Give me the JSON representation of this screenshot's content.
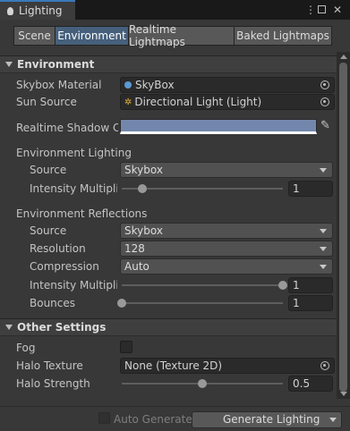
{
  "window": {
    "title": "Lighting"
  },
  "toolbar": {
    "tabs": [
      "Scene",
      "Environment",
      "Realtime Lightmaps",
      "Baked Lightmaps"
    ],
    "active": "Environment"
  },
  "environment": {
    "header": "Environment",
    "skybox_material": {
      "label": "Skybox Material",
      "value": "SkyBox"
    },
    "sun_source": {
      "label": "Sun Source",
      "value": "Directional Light (Light)"
    },
    "shadow_color": {
      "label": "Realtime Shadow Color",
      "color": "#7387ac"
    },
    "lighting": {
      "header": "Environment Lighting",
      "source": {
        "label": "Source",
        "value": "Skybox"
      },
      "intensity": {
        "label": "Intensity Multiplier",
        "value": "1",
        "fraction": 0.125
      }
    },
    "reflections": {
      "header": "Environment Reflections",
      "source": {
        "label": "Source",
        "value": "Skybox"
      },
      "resolution": {
        "label": "Resolution",
        "value": "128"
      },
      "compression": {
        "label": "Compression",
        "value": "Auto"
      },
      "intensity": {
        "label": "Intensity Multiplier",
        "value": "1",
        "fraction": 1.0
      },
      "bounces": {
        "label": "Bounces",
        "value": "1",
        "fraction": 0.0
      }
    }
  },
  "other": {
    "header": "Other Settings",
    "fog": {
      "label": "Fog",
      "checked": false
    },
    "halo_texture": {
      "label": "Halo Texture",
      "value": "None (Texture 2D)"
    },
    "halo_strength": {
      "label": "Halo Strength",
      "value": "0.5",
      "fraction": 0.5
    }
  },
  "bottom": {
    "auto_generate": "Auto Generate",
    "generate": "Generate Lighting"
  },
  "colors": {
    "accent": "#3a79bb",
    "active_tab": "#46607c"
  }
}
